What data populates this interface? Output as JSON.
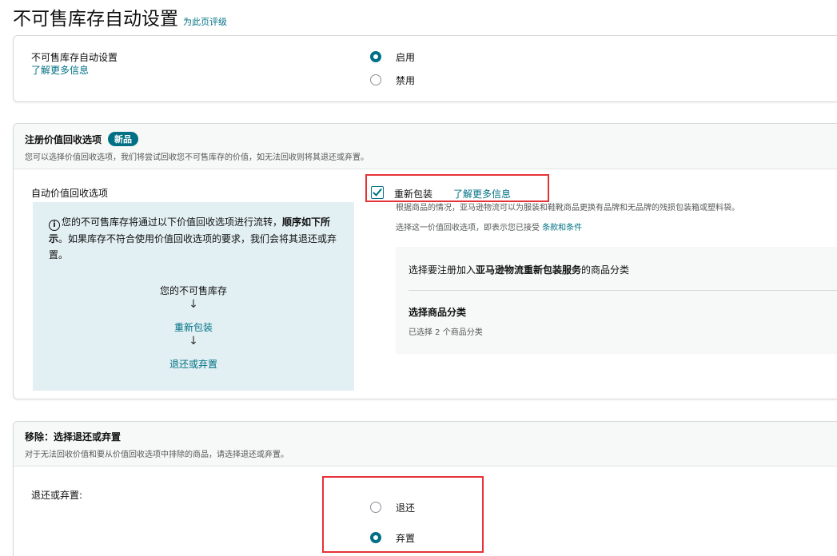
{
  "page": {
    "title": "不可售库存自动设置",
    "rate_link": "为此页评级"
  },
  "auto_settings": {
    "label": "不可售库存自动设置",
    "learn_more": "了解更多信息",
    "options": [
      {
        "label": "启用",
        "selected": true
      },
      {
        "label": "禁用",
        "selected": false
      }
    ]
  },
  "recovery": {
    "heading": "注册价值回收选项",
    "badge": "新品",
    "subtitle": "您可以选择价值回收选项，我们将尝试回收您不可售库存的价值，如无法回收则将其退还或弃置。",
    "auto_label": "自动价值回收选项",
    "info_text_1": "您的不可售库存将通过以下价值回收选项进行流转，",
    "info_text_bold": "顺序如下所示",
    "info_text_2": "。如果库存不符合使用价值回收选项的要求，我们会将其退还或弃置。",
    "info_icon": "i",
    "flow": {
      "start": "您的不可售库存",
      "arrow": "↓",
      "step1": "重新包装",
      "step2": "退还或弃置"
    },
    "repack": {
      "checked": true,
      "label": "重新包装",
      "learn_more": "了解更多信息",
      "description": "根据商品的情况，亚马逊物流可以为服装和鞋靴商品更换有品牌和无品牌的残损包装箱或塑料袋。",
      "terms_prefix": "选择这一价值回收选项，即表示您已接受",
      "terms_link": "条款和条件"
    },
    "category": {
      "intro_prefix": "选择要注册加入",
      "intro_bold": "亚马逊物流重新包装服务",
      "intro_suffix": "的商品分类",
      "select_title": "选择商品分类",
      "selected_count": "已选择 2 个商品分类"
    }
  },
  "removal": {
    "heading": "移除：选择退还或弃置",
    "subtitle": "对于无法回收价值和要从价值回收选项中排除的商品，请选择退还或弃置。",
    "label": "退还或弃置:",
    "options": [
      {
        "label": "退还",
        "selected": false
      },
      {
        "label": "弃置",
        "selected": true
      }
    ]
  },
  "colors": {
    "accent": "#007185",
    "highlight": "#e53238",
    "info_bg": "#e2eff3"
  }
}
